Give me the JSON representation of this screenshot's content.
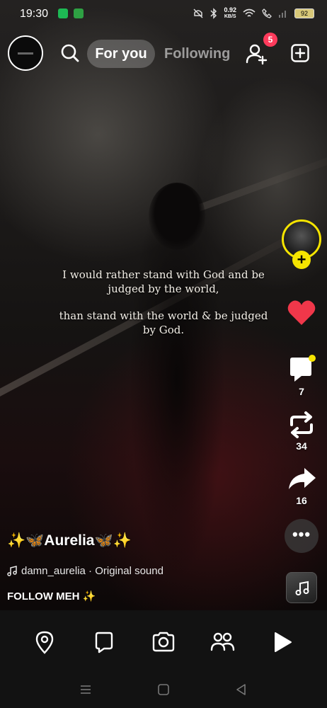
{
  "status_bar": {
    "time": "19:30",
    "net_speed_value": "0.92",
    "net_speed_unit": "KB/S",
    "battery": "92"
  },
  "header": {
    "tabs": [
      {
        "label": "For you",
        "active": true
      },
      {
        "label": "Following",
        "active": false
      }
    ],
    "friend_requests_badge": "5"
  },
  "video": {
    "quote_line_1": "I would rather stand with God and be judged by the world,",
    "quote_line_2": "than stand with the world & be judged by God."
  },
  "actions": {
    "comments": "7",
    "reposts": "34",
    "shares": "16"
  },
  "caption": {
    "username": "✨🦋Aurelia🦋✨",
    "sound": "damn_aurelia · Original sound",
    "description": "FOLLOW MEH ✨"
  },
  "bottom_nav": {
    "items": [
      "location-icon",
      "chat-icon",
      "camera-icon",
      "friends-icon",
      "play-icon"
    ]
  },
  "colors": {
    "accent_yellow": "#f5e400",
    "badge_red": "#ff3b5c",
    "like_red": "#f0374a"
  }
}
